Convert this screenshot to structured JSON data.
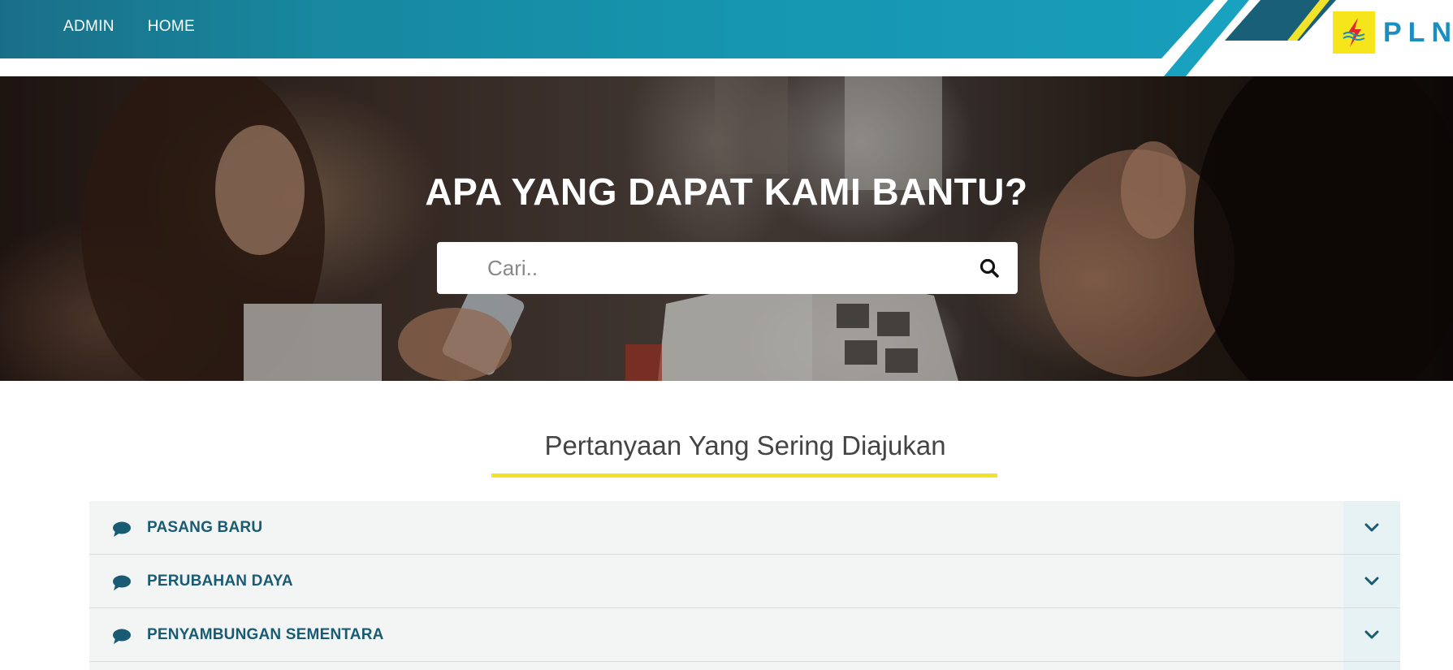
{
  "nav": {
    "links": [
      "ADMIN",
      "HOME"
    ],
    "logo_text": "PLN"
  },
  "hero": {
    "title": "APA YANG DAPAT KAMI BANTU?",
    "search_placeholder": "Cari..",
    "search_value": ""
  },
  "faq": {
    "title": "Pertanyaan Yang Sering Diajukan",
    "items": [
      {
        "label": "PASANG BARU"
      },
      {
        "label": "PERUBAHAN DAYA"
      },
      {
        "label": "PENYAMBUNGAN SEMENTARA"
      }
    ]
  },
  "colors": {
    "nav_bar": "#17889f",
    "accent_yellow": "#f2e32a",
    "faq_text": "#195b72",
    "faq_bg": "#f3f5f5"
  },
  "icons": {
    "search": "search-icon",
    "faq_item": "chat-icon",
    "toggle": "chevron-down-icon",
    "logo": "lightning-icon"
  }
}
